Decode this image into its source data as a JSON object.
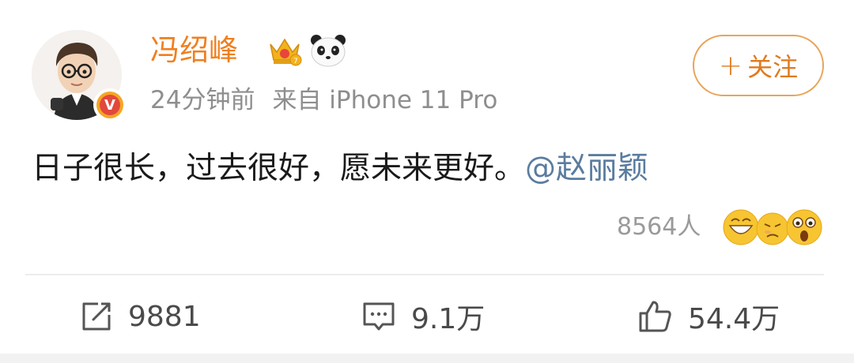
{
  "post": {
    "author_name": "冯绍峰",
    "time": "24分钟前",
    "source": "来自 iPhone 11 Pro",
    "follow_label": "关注",
    "follow_plus": "+",
    "text_body": "日子很长，过去很好，愿未来更好。",
    "mention": "@赵丽颖",
    "reaction_count": "8564人",
    "verified_badge": "V"
  },
  "actions": {
    "repost_count": "9881",
    "comment_count": "9.1万",
    "like_count": "54.4万"
  },
  "icons": {
    "avatar": "cartoon-avatar",
    "crown": "crown-badge-icon",
    "panda": "panda-icon",
    "repost": "share-icon",
    "comment": "comment-icon",
    "like": "thumbs-up-icon"
  },
  "colors": {
    "name": "#f07f1f",
    "meta": "#8e8e8e",
    "mention": "#5b7c9f",
    "follow_border": "#e8a45a"
  }
}
